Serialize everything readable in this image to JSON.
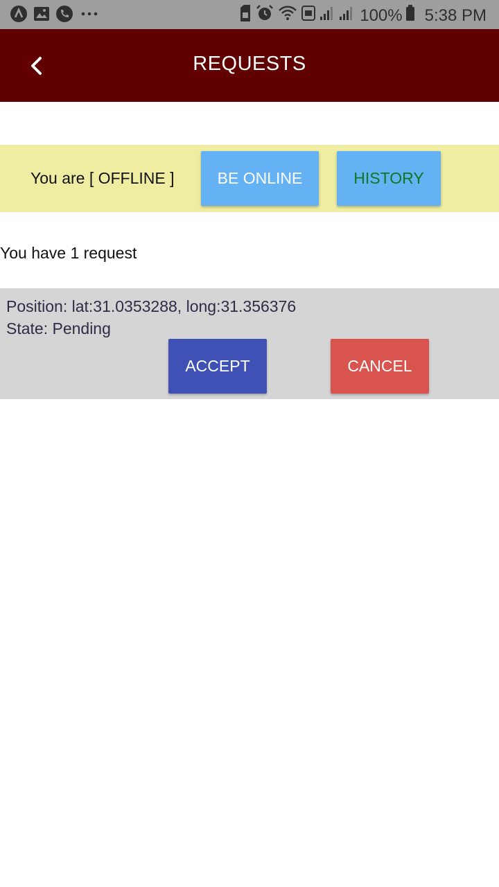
{
  "status_bar": {
    "battery_percent": "100%",
    "time": "5:38 PM",
    "icons": [
      "app-a-icon",
      "image-icon",
      "phone-icon",
      "more-dots-icon",
      "sim-icon",
      "alarm-icon",
      "wifi-icon",
      "hd-icon",
      "signal-icon",
      "signal-icon",
      "battery-icon"
    ]
  },
  "app_bar": {
    "title": "REQUESTS",
    "background": "#610000"
  },
  "availability": {
    "label": "You are [ OFFLINE ]",
    "be_online_label": "BE ONLINE",
    "history_label": "HISTORY",
    "strip_color": "#eeeda2",
    "button_color": "#64b2f4"
  },
  "summary": {
    "request_count_text": "You have 1 request"
  },
  "requests": [
    {
      "position_text": "Position: lat:31.0353288, long:31.356376",
      "state_text": "State: Pending",
      "accept_label": "ACCEPT",
      "cancel_label": "CANCEL",
      "accept_color": "#3f51b5",
      "cancel_color": "#d9534f"
    }
  ]
}
